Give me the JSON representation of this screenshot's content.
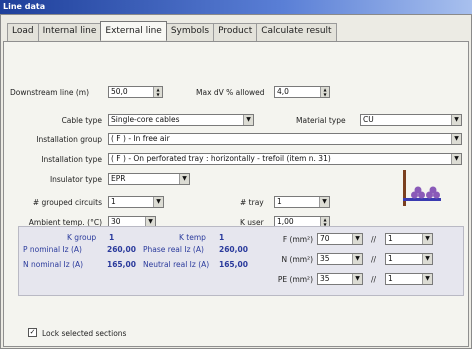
{
  "window": {
    "title": "Line data"
  },
  "tabs": [
    "Load",
    "Internal line",
    "External line",
    "Symbols",
    "Product",
    "Calculate result"
  ],
  "active_tab": "External line",
  "form": {
    "downstream_line_label": "Downstream line (m)",
    "downstream_line_value": "50,0",
    "max_dv_label": "Max dV % allowed",
    "max_dv_value": "4,0",
    "cable_type_label": "Cable type",
    "cable_type_value": "Single-core cables",
    "material_type_label": "Material type",
    "material_type_value": "CU",
    "installation_group_label": "Installation group",
    "installation_group_value": "( F ) - In free air",
    "installation_type_label": "Installation type",
    "installation_type_value": "( F ) - On perforated tray : horizontally - trefoil (item n. 31)",
    "insulator_type_label": "Insulator type",
    "insulator_type_value": "EPR",
    "grouped_circuits_label": "# grouped circuits",
    "grouped_circuits_value": "1",
    "tray_label": "# tray",
    "tray_value": "1",
    "ambient_temp_label": "Ambient temp. (°C)",
    "ambient_temp_value": "30",
    "k_user_label": "K user",
    "k_user_value": "1,00"
  },
  "results": {
    "k_group_label": "K group",
    "k_group_value": "1",
    "k_temp_label": "K temp",
    "k_temp_value": "1",
    "p_nominal_label": "P nominal Iz (A)",
    "p_nominal_value": "260,00",
    "phase_real_label": "Phase real Iz (A)",
    "phase_real_value": "260,00",
    "n_nominal_label": "N nominal Iz (A)",
    "n_nominal_value": "165,00",
    "neutral_real_label": "Neutral real Iz (A)",
    "neutral_real_value": "165,00"
  },
  "sections": {
    "f_label": "F (mm²)",
    "f_value": "70",
    "f_count": "1",
    "n_label": "N (mm²)",
    "n_value": "35",
    "n_count": "1",
    "pe_label": "PE (mm²)",
    "pe_value": "35",
    "pe_count": "1",
    "separator": "//"
  },
  "lock_sections_label": "Lock selected sections",
  "lock_sections_checked": true
}
